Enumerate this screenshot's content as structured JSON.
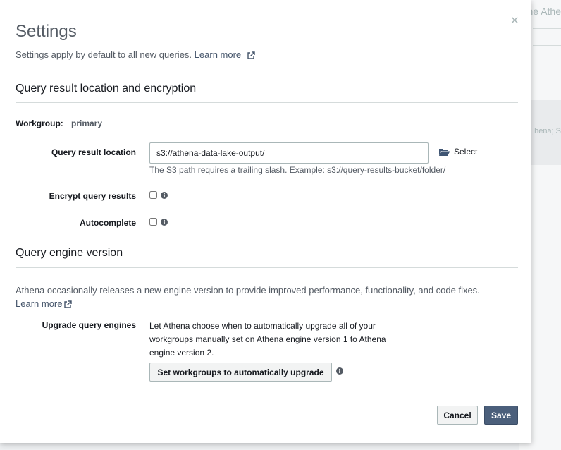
{
  "background": {
    "partial_text_top": "ne Athe",
    "partial_text_mid": "hena; S"
  },
  "modal": {
    "title": "Settings",
    "subtitle": "Settings apply by default to all new queries.",
    "learn_more": "Learn more",
    "close_icon": "close-icon"
  },
  "result_section": {
    "header": "Query result location and encryption",
    "workgroup_label": "Workgroup:",
    "workgroup_value": "primary",
    "location_label": "Query result location",
    "location_value": "s3://athena-data-lake-output/",
    "select_label": "Select",
    "hint": "The S3 path requires a trailing slash. Example: s3://query-results-bucket/folder/",
    "encrypt_label": "Encrypt query results",
    "encrypt_checked": false,
    "autocomplete_label": "Autocomplete",
    "autocomplete_checked": false
  },
  "engine_section": {
    "header": "Query engine version",
    "description": "Athena occasionally releases a new engine version to provide improved performance, functionality, and code fixes.",
    "learn_more": "Learn more",
    "upgrade_label": "Upgrade query engines",
    "upgrade_text": "Let Athena choose when to automatically upgrade all of your workgroups manually set on Athena engine version 1 to Athena engine version 2.",
    "upgrade_button": "Set workgroups to automatically upgrade"
  },
  "footer": {
    "cancel": "Cancel",
    "save": "Save"
  },
  "colors": {
    "primary_button": "#4b5f7b",
    "link": "#44546a",
    "text_secondary": "#545b64"
  }
}
